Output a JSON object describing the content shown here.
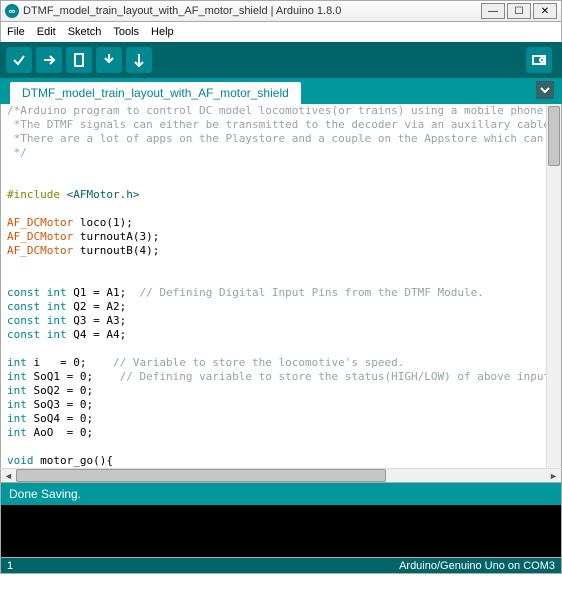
{
  "window": {
    "title": "DTMF_model_train_layout_with_AF_motor_shield | Arduino 1.8.0",
    "icon_glyph": "∞"
  },
  "menubar": [
    "File",
    "Edit",
    "Sketch",
    "Tools",
    "Help"
  ],
  "tab": {
    "label": "DTMF_model_train_layout_with_AF_motor_shield"
  },
  "code": {
    "lines": [
      {
        "spans": [
          {
            "cls": "c1",
            "t": "/*Arduino program to control DC model locomotives(or trains) using a mobile phone through DT"
          }
        ]
      },
      {
        "spans": [
          {
            "cls": "c1",
            "t": " *The DTMF signals can either be transmitted to the decoder via an auxillary cable or wirele"
          }
        ]
      },
      {
        "spans": [
          {
            "cls": "c1",
            "t": " *There are a lot of apps on the Playstore and a couple on the Appstore which can be used in"
          }
        ]
      },
      {
        "spans": [
          {
            "cls": "c1",
            "t": " */"
          }
        ]
      },
      {
        "spans": [
          {
            "cls": "c3",
            "t": ""
          }
        ]
      },
      {
        "spans": [
          {
            "cls": "c3",
            "t": ""
          }
        ]
      },
      {
        "spans": [
          {
            "cls": "c6",
            "t": "#include "
          },
          {
            "cls": "c5",
            "t": "<AFMotor.h>"
          }
        ]
      },
      {
        "spans": [
          {
            "cls": "c3",
            "t": ""
          }
        ]
      },
      {
        "spans": [
          {
            "cls": "c2",
            "t": "AF_DCMotor"
          },
          {
            "cls": "c3",
            "t": " loco(1);"
          }
        ]
      },
      {
        "spans": [
          {
            "cls": "c2",
            "t": "AF_DCMotor"
          },
          {
            "cls": "c3",
            "t": " turnoutA(3);"
          }
        ]
      },
      {
        "spans": [
          {
            "cls": "c2",
            "t": "AF_DCMotor"
          },
          {
            "cls": "c3",
            "t": " turnoutB(4);"
          }
        ]
      },
      {
        "spans": [
          {
            "cls": "c3",
            "t": ""
          }
        ]
      },
      {
        "spans": [
          {
            "cls": "c3",
            "t": ""
          }
        ]
      },
      {
        "spans": [
          {
            "cls": "c4",
            "t": "const"
          },
          {
            "cls": "c3",
            "t": " "
          },
          {
            "cls": "c4",
            "t": "int"
          },
          {
            "cls": "c3",
            "t": " Q1 = A1;  "
          },
          {
            "cls": "c1",
            "t": "// Defining Digital Input Pins from the DTMF Module."
          }
        ]
      },
      {
        "spans": [
          {
            "cls": "c4",
            "t": "const"
          },
          {
            "cls": "c3",
            "t": " "
          },
          {
            "cls": "c4",
            "t": "int"
          },
          {
            "cls": "c3",
            "t": " Q2 = A2;"
          }
        ]
      },
      {
        "spans": [
          {
            "cls": "c4",
            "t": "const"
          },
          {
            "cls": "c3",
            "t": " "
          },
          {
            "cls": "c4",
            "t": "int"
          },
          {
            "cls": "c3",
            "t": " Q3 = A3;"
          }
        ]
      },
      {
        "spans": [
          {
            "cls": "c4",
            "t": "const"
          },
          {
            "cls": "c3",
            "t": " "
          },
          {
            "cls": "c4",
            "t": "int"
          },
          {
            "cls": "c3",
            "t": " Q4 = A4;"
          }
        ]
      },
      {
        "spans": [
          {
            "cls": "c3",
            "t": ""
          }
        ]
      },
      {
        "spans": [
          {
            "cls": "c4",
            "t": "int"
          },
          {
            "cls": "c3",
            "t": " i   = 0;    "
          },
          {
            "cls": "c1",
            "t": "// Variable to store the locomotive's speed."
          }
        ]
      },
      {
        "spans": [
          {
            "cls": "c4",
            "t": "int"
          },
          {
            "cls": "c3",
            "t": " SoQ1 = 0;    "
          },
          {
            "cls": "c1",
            "t": "// Defining variable to store the status(HIGH/LOW) of above inputs."
          }
        ]
      },
      {
        "spans": [
          {
            "cls": "c4",
            "t": "int"
          },
          {
            "cls": "c3",
            "t": " SoQ2 = 0;"
          }
        ]
      },
      {
        "spans": [
          {
            "cls": "c4",
            "t": "int"
          },
          {
            "cls": "c3",
            "t": " SoQ3 = 0;"
          }
        ]
      },
      {
        "spans": [
          {
            "cls": "c4",
            "t": "int"
          },
          {
            "cls": "c3",
            "t": " SoQ4 = 0;"
          }
        ]
      },
      {
        "spans": [
          {
            "cls": "c4",
            "t": "int"
          },
          {
            "cls": "c3",
            "t": " AoO  = 0;"
          }
        ]
      },
      {
        "spans": [
          {
            "cls": "c3",
            "t": ""
          }
        ]
      },
      {
        "spans": [
          {
            "cls": "c4",
            "t": "void"
          },
          {
            "cls": "c3",
            "t": " motor_go(){"
          }
        ]
      }
    ]
  },
  "status_text": "Done Saving.",
  "footer": {
    "line": "1",
    "board": "Arduino/Genuino Uno on COM3"
  }
}
